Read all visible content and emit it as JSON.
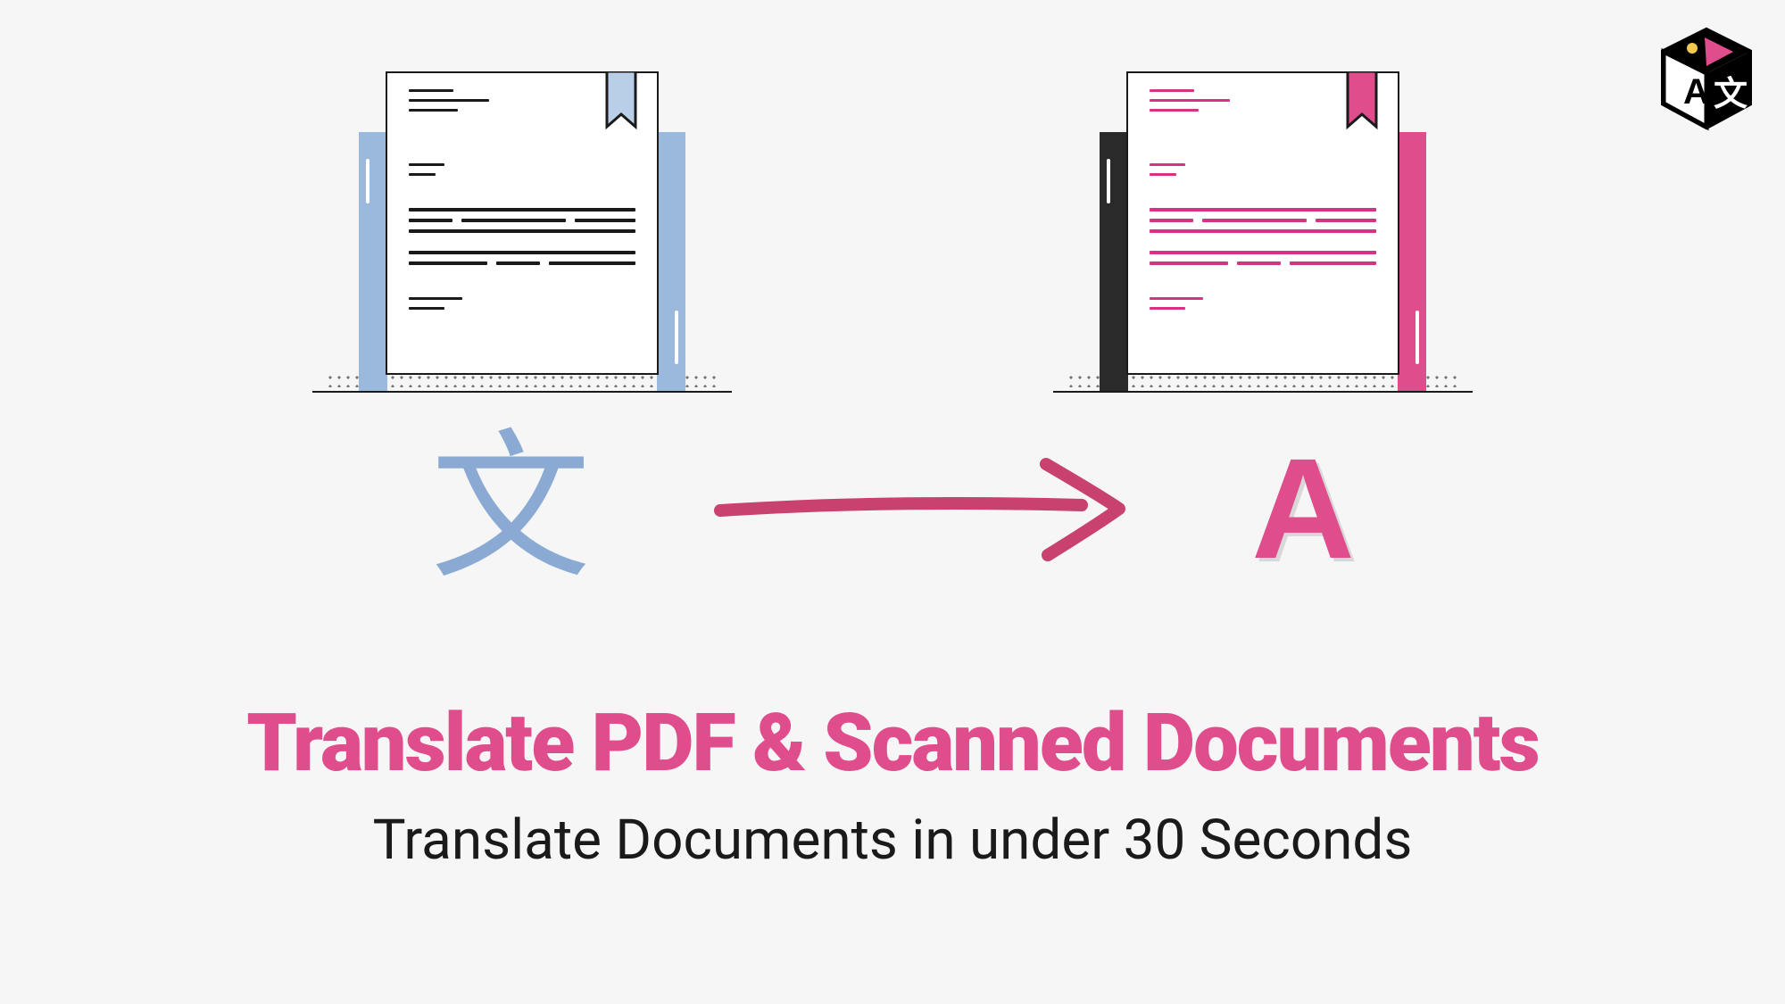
{
  "headline": "Translate PDF & Scanned Documents",
  "subline": "Translate Documents in under 30 Seconds",
  "source_glyph": "文",
  "target_glyph": "A",
  "logo_letter_a": "A",
  "logo_letter_b": "文",
  "colors": {
    "pink": "#e04d8c",
    "blue": "#8aaad3",
    "black": "#1a1a1a"
  }
}
